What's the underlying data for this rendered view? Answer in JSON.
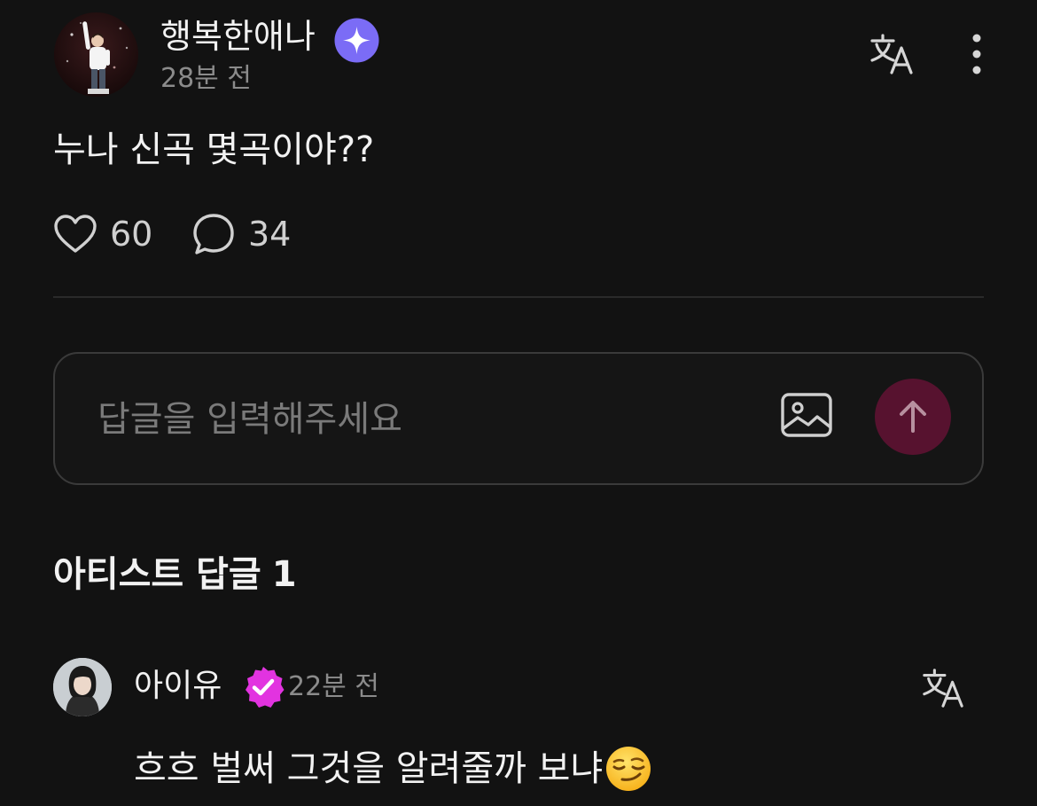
{
  "post": {
    "author_name": "행복한애나",
    "time": "28분 전",
    "body": "누나 신곡 몇곡이야??",
    "likes": "60",
    "comments": "34"
  },
  "reply_input": {
    "placeholder": "답글을 입력해주세요"
  },
  "artist_replies": {
    "title": "아티스트 답글",
    "count": "1",
    "items": [
      {
        "author": "아이유",
        "time": "22분 전",
        "body": "흐흐 벌써 그것을 알려줄까 보냐",
        "emoji": "smirking-face-emoji"
      }
    ]
  },
  "colors": {
    "background": "#121212",
    "sparkle_badge": "#7b6cf6",
    "verified_badge": "#e233e0",
    "send_button": "#57122f",
    "muted_text": "#8b8b8b"
  },
  "icons": {
    "sparkle": "sparkle-badge-icon",
    "verified": "verified-check-icon",
    "translate": "translate-icon",
    "more": "more-vertical-icon",
    "like": "heart-icon",
    "comment": "comment-bubble-icon",
    "image": "image-icon",
    "send": "arrow-up-icon"
  }
}
